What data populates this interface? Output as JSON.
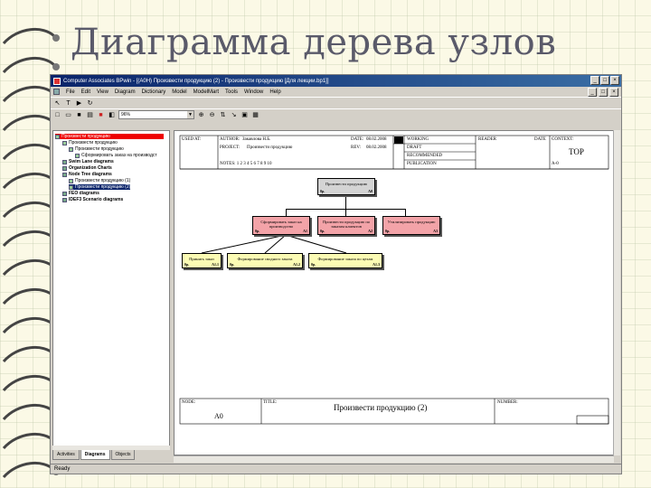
{
  "slide": {
    "title": "Диаграмма дерева узлов"
  },
  "window": {
    "title": "Computer Associates BPwin - [(A0H) Произвести продукцию (2) - Произвести продукцию [Для лекции.bp1]]",
    "menu": [
      "File",
      "Edit",
      "View",
      "Diagram",
      "Dictionary",
      "Model",
      "ModelMart",
      "Tools",
      "Window",
      "Help"
    ],
    "zoom": "96%",
    "status": "Ready"
  },
  "tree": {
    "items": [
      "Произвести продукцию",
      "Произвести продукцию",
      "Произвести продукцию",
      "Сформировать заказ на производст",
      "Swim Lane diagrams",
      "Organization Charts",
      "Node Tree diagrams",
      "Произвести продукцию (1)",
      "Произвести продукцию (2)",
      "FEO diagrams",
      "IDEF3 Scenario diagrams"
    ],
    "tabs": [
      "Activities",
      "Diagrams",
      "Objects"
    ]
  },
  "frame": {
    "used_at_label": "USED AT:",
    "author_label": "AUTHOR:",
    "author": "Закавлова Н.Б.",
    "project_label": "PROJECT:",
    "project": "Произвести продукцию",
    "date_label": "DATE:",
    "date": "08.02.2008",
    "rev_label": "REV:",
    "rev": "08.02.2008",
    "notes": "NOTES: 1 2 3 4 5 6 7 8 9 10",
    "working": "WORKING",
    "draft": "DRAFT",
    "recommended": "RECOMMENDED",
    "publication": "PUBLICATION",
    "reader": "READER",
    "date2": "DATE",
    "context_label": "CONTEXT:",
    "context_value": "TOP",
    "context_node": "A-0",
    "node_label": "NODE:",
    "node_value": "A0",
    "title_label": "TITLE:",
    "title_value": "Произвести продукцию (2)",
    "number_label": "NUMBER:"
  },
  "nodes": {
    "root": {
      "text": "Произвести продукцию",
      "left": "0р.",
      "num": "A0"
    },
    "a1": {
      "text": "Сформировать заказ на производство",
      "left": "0р.",
      "num": "A1"
    },
    "a2": {
      "text": "Произвести продукцию по заказам клиентов",
      "left": "0р.",
      "num": "A2"
    },
    "a3": {
      "text": "Утилизировать продукцию",
      "left": "0р.",
      "num": "A3"
    },
    "a11": {
      "text": "Принять заказ",
      "left": "0р.",
      "num": "A1.1"
    },
    "a12": {
      "text": "Формирование сводного заказа",
      "left": "0р.",
      "num": "A1.2"
    },
    "a13": {
      "text": "Формирование заказа по цехам",
      "left": "0р.",
      "num": "A1.3"
    }
  },
  "colors": {
    "pink": "#f3a3a8",
    "yellow": "#fbfbb4",
    "gray": "#d4d4d4",
    "titlebar": "#0a246a",
    "selection_red": "#e00000"
  }
}
